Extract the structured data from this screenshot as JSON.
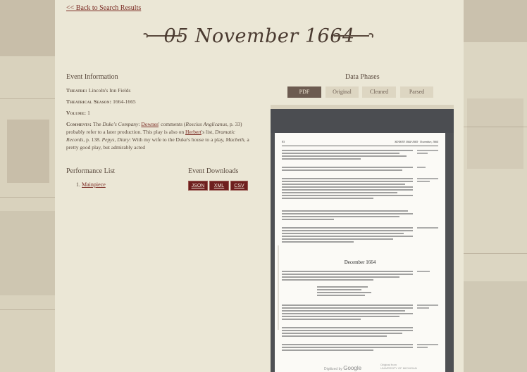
{
  "back_link": "<< Back to Search Results",
  "date_title": "05 November 1664",
  "event_info": {
    "heading": "Event Information",
    "theatre_label": "Theatre:",
    "theatre_value": "Lincoln's Inn Fields",
    "season_label": "Theatrical Season:",
    "season_value": "1664-1665",
    "volume_label": "Volume:",
    "volume_value": "1",
    "comments_label": "Comments:",
    "comments_parts": {
      "p1": "The ",
      "p2": "Duke's Company",
      "p3": ": ",
      "link1": "Downes",
      "p4": "' comments (",
      "p5": "Roscius Anglicanus",
      "p6": ", p. 33) probably refer to a later production. This play is also on ",
      "link2": "Herbert",
      "p7": "'s list, ",
      "p8": "Dramatic Records",
      "p9": ", p. 138. ",
      "p10": "Pepys, Diary",
      "p11": ": With my wife to the Duke's house to a play, ",
      "p12": "Macbeth",
      "p13": ", a pretty good play, but admirably acted"
    }
  },
  "performance_list": {
    "heading": "Performance List",
    "items": [
      "Mainpiece"
    ],
    "item_number": "1."
  },
  "event_downloads": {
    "heading": "Event Downloads",
    "buttons": [
      "JSON",
      "XML",
      "CSV"
    ]
  },
  "data_phases": {
    "heading": "Data Phases",
    "tabs": [
      "PDF",
      "Original",
      "Cleaned",
      "Parsed"
    ],
    "active_tab": "PDF"
  },
  "pdf_page": {
    "page_number": "83",
    "running_head": "SEASON 1664-1665 · November, 1664",
    "month_heading": "December 1664",
    "digitized_by": "Digitized by",
    "google": "Google",
    "original_from": "Original from",
    "university": "UNIVERSITY OF MICHIGAN"
  },
  "colors": {
    "link": "#7a2a22",
    "button_bg": "#6e1f1e",
    "tab_active": "#6c5b50",
    "background": "#ebe7d6"
  }
}
